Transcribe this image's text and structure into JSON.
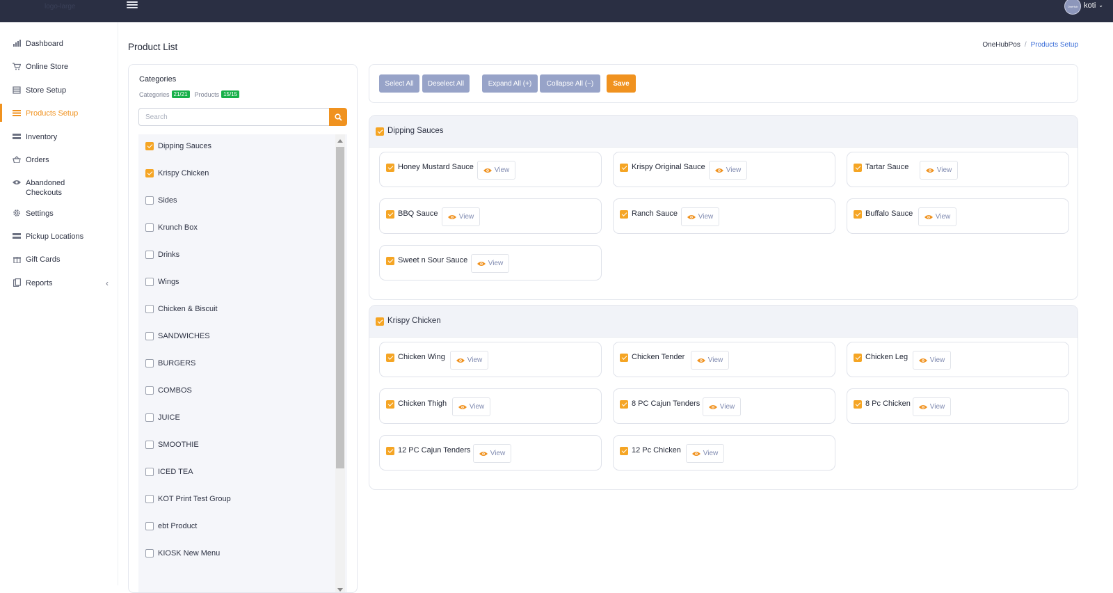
{
  "topbar": {
    "logo_text": "logo-large",
    "user_name": "koti",
    "avatar_text": "OneHub"
  },
  "sidebar": {
    "items": [
      {
        "label": "Dashboard",
        "icon": "chart-bar-icon"
      },
      {
        "label": "Online Store",
        "icon": "cart-icon"
      },
      {
        "label": "Store Setup",
        "icon": "store-icon"
      },
      {
        "label": "Products Setup",
        "icon": "list-icon",
        "active": true
      },
      {
        "label": "Inventory",
        "icon": "inventory-icon"
      },
      {
        "label": "Orders",
        "icon": "basket-icon"
      },
      {
        "label": "Abandoned Checkouts",
        "icon": "eye-icon"
      },
      {
        "label": "Settings",
        "icon": "gear-icon"
      },
      {
        "label": "Pickup Locations",
        "icon": "location-list-icon"
      },
      {
        "label": "Gift Cards",
        "icon": "gift-icon"
      },
      {
        "label": "Reports",
        "icon": "reports-icon"
      }
    ]
  },
  "header": {
    "title": "Product List",
    "breadcrumb_root": "OneHubPos",
    "breadcrumb_current": "Products Setup",
    "breadcrumb_sep": "/"
  },
  "categories_panel": {
    "title": "Categories",
    "categories_label": "Categories",
    "categories_count": "21/21",
    "products_label": "Products",
    "products_count": "15/15",
    "search_placeholder": "Search",
    "items": [
      {
        "label": "Dipping Sauces",
        "checked": true
      },
      {
        "label": "Krispy Chicken",
        "checked": true
      },
      {
        "label": "Sides",
        "checked": false
      },
      {
        "label": "Krunch Box",
        "checked": false
      },
      {
        "label": "Drinks",
        "checked": false
      },
      {
        "label": "Wings",
        "checked": false
      },
      {
        "label": "Chicken & Biscuit",
        "checked": false
      },
      {
        "label": "SANDWICHES",
        "checked": false
      },
      {
        "label": "BURGERS",
        "checked": false
      },
      {
        "label": "COMBOS",
        "checked": false
      },
      {
        "label": "JUICE",
        "checked": false
      },
      {
        "label": "SMOOTHIE",
        "checked": false
      },
      {
        "label": "ICED TEA",
        "checked": false
      },
      {
        "label": "KOT Print Test Group",
        "checked": false
      },
      {
        "label": "ebt Product",
        "checked": false
      },
      {
        "label": "KIOSK New Menu",
        "checked": false
      }
    ]
  },
  "toolbar": {
    "select_all": "Select All",
    "deselect_all": "Deselect All",
    "expand_all": "Expand All (+)",
    "collapse_all": "Collapse All (−)",
    "save": "Save"
  },
  "view_label": "View",
  "groups": [
    {
      "title": "Dipping Sauces",
      "checked": true,
      "products": [
        {
          "name": "Honey Mustard Sauce",
          "checked": true
        },
        {
          "name": "Krispy Original Sauce",
          "checked": true
        },
        {
          "name": "Tartar Sauce",
          "checked": true
        },
        {
          "name": "BBQ Sauce",
          "checked": true
        },
        {
          "name": "Ranch Sauce",
          "checked": true
        },
        {
          "name": "Buffalo Sauce",
          "checked": true
        },
        {
          "name": "Sweet n Sour Sauce",
          "checked": true
        }
      ]
    },
    {
      "title": "Krispy Chicken",
      "checked": true,
      "products": [
        {
          "name": "Chicken Wing",
          "checked": true
        },
        {
          "name": "Chicken Tender",
          "checked": true
        },
        {
          "name": "Chicken Leg",
          "checked": true
        },
        {
          "name": "Chicken Thigh",
          "checked": true
        },
        {
          "name": "8 PC Cajun Tenders",
          "checked": true
        },
        {
          "name": "8 Pc Chicken",
          "checked": true
        },
        {
          "name": "12 PC Cajun Tenders",
          "checked": true
        },
        {
          "name": "12 Pc Chicken",
          "checked": true
        }
      ]
    }
  ],
  "colors": {
    "accent": "#f0921f",
    "checkbox": "#f5a524",
    "topbar": "#2a2f43",
    "badge": "#18b04a",
    "button_gray": "#97a3c8",
    "link": "#3b6ed8"
  }
}
